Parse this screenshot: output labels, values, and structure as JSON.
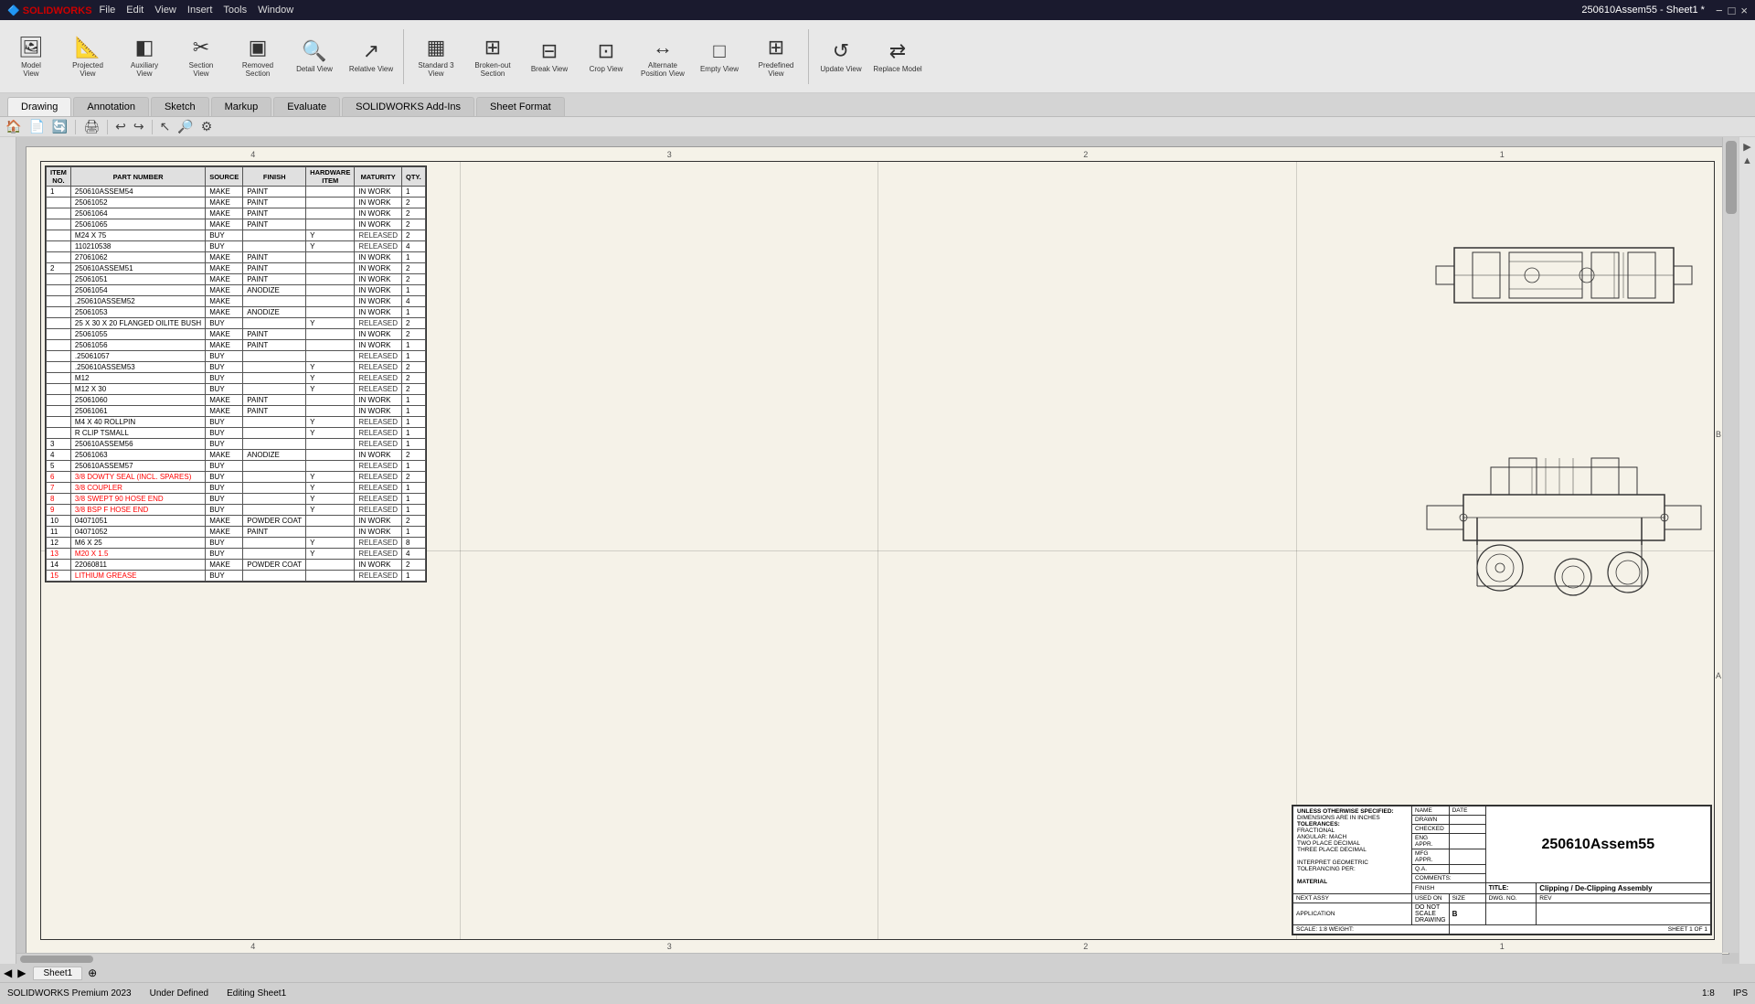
{
  "app": {
    "name": "SOLIDWORKS",
    "title": "250610Assem55 - Sheet1 *",
    "version": "SOLIDWORKS Premium 2023"
  },
  "menus": [
    "File",
    "Edit",
    "View",
    "Insert",
    "Tools",
    "Window"
  ],
  "toolbar": {
    "buttons": [
      {
        "id": "model-view",
        "label": "Model\nView",
        "icon": "🖼"
      },
      {
        "id": "projected-view",
        "label": "Projected\nView",
        "icon": "📐"
      },
      {
        "id": "auxiliary-view",
        "label": "Auxiliary\nView",
        "icon": "◧"
      },
      {
        "id": "section-view",
        "label": "Section\nView",
        "icon": "✂"
      },
      {
        "id": "removed-section",
        "label": "Removed\nSection",
        "icon": "▣"
      },
      {
        "id": "detail-view",
        "label": "Detail\nView",
        "icon": "🔍"
      },
      {
        "id": "relative-view",
        "label": "Relative\nView",
        "icon": "↗"
      },
      {
        "id": "standard-3-view",
        "label": "Standard\n3 View",
        "icon": "▦"
      },
      {
        "id": "broken-out-section",
        "label": "Broken-out\nSection",
        "icon": "⊞"
      },
      {
        "id": "break-view",
        "label": "Break\nView",
        "icon": "⊟"
      },
      {
        "id": "crop-view",
        "label": "Crop\nView",
        "icon": "⊡"
      },
      {
        "id": "alternate-position-view",
        "label": "Alternate\nPosition\nView",
        "icon": "↔"
      },
      {
        "id": "empty-view",
        "label": "Empty\nView",
        "icon": "□"
      },
      {
        "id": "predefined-view",
        "label": "Predefined\nView",
        "icon": "⊞"
      },
      {
        "id": "update-view",
        "label": "Update\nView",
        "icon": "↺"
      },
      {
        "id": "replace-model",
        "label": "Replace\nModel",
        "icon": "⇄"
      }
    ]
  },
  "tabs": [
    {
      "id": "drawing",
      "label": "Drawing"
    },
    {
      "id": "annotation",
      "label": "Annotation"
    },
    {
      "id": "sketch",
      "label": "Sketch"
    },
    {
      "id": "markup",
      "label": "Markup"
    },
    {
      "id": "evaluate",
      "label": "Evaluate"
    },
    {
      "id": "solidworks-addins",
      "label": "SOLIDWORKS Add-Ins"
    },
    {
      "id": "sheet-format",
      "label": "Sheet Format"
    }
  ],
  "active_tab": "Drawing",
  "bom": {
    "columns": [
      "ITEM NO.",
      "PART NUMBER",
      "SOURCE",
      "FINISH",
      "HARDWARE ITEM",
      "MATURITY",
      "QTY."
    ],
    "rows": [
      {
        "item": "1",
        "part": "250610ASSEM54",
        "source": "MAKE",
        "finish": "PAINT",
        "hw": "",
        "maturity": "IN WORK",
        "qty": "1",
        "red": false
      },
      {
        "item": "",
        "part": "25061052",
        "source": "MAKE",
        "finish": "PAINT",
        "hw": "",
        "maturity": "IN WORK",
        "qty": "2",
        "red": false
      },
      {
        "item": "",
        "part": "25061064",
        "source": "MAKE",
        "finish": "PAINT",
        "hw": "",
        "maturity": "IN WORK",
        "qty": "2",
        "red": false
      },
      {
        "item": "",
        "part": "25061065",
        "source": "MAKE",
        "finish": "PAINT",
        "hw": "",
        "maturity": "IN WORK",
        "qty": "2",
        "red": false
      },
      {
        "item": "",
        "part": "M24 X 75",
        "source": "BUY",
        "finish": "",
        "hw": "Y",
        "maturity": "RELEASED",
        "qty": "2",
        "red": false
      },
      {
        "item": "",
        "part": "110210538",
        "source": "BUY",
        "finish": "",
        "hw": "Y",
        "maturity": "RELEASED",
        "qty": "4",
        "red": false
      },
      {
        "item": "",
        "part": "27061062",
        "source": "MAKE",
        "finish": "PAINT",
        "hw": "",
        "maturity": "IN WORK",
        "qty": "1",
        "red": false
      },
      {
        "item": "2",
        "part": "250610ASSEM51",
        "source": "MAKE",
        "finish": "PAINT",
        "hw": "",
        "maturity": "IN WORK",
        "qty": "2",
        "red": false
      },
      {
        "item": "",
        "part": "25061051",
        "source": "MAKE",
        "finish": "PAINT",
        "hw": "",
        "maturity": "IN WORK",
        "qty": "2",
        "red": false
      },
      {
        "item": "",
        "part": "25061054",
        "source": "MAKE",
        "finish": "ANODIZE",
        "hw": "",
        "maturity": "IN WORK",
        "qty": "1",
        "red": false
      },
      {
        "item": "",
        "part": ".250610ASSEM52",
        "source": "MAKE",
        "finish": "",
        "hw": "",
        "maturity": "IN WORK",
        "qty": "4",
        "red": false
      },
      {
        "item": "",
        "part": "25061053",
        "source": "MAKE",
        "finish": "ANODIZE",
        "hw": "",
        "maturity": "IN WORK",
        "qty": "1",
        "red": false
      },
      {
        "item": "",
        "part": "25 X 30 X 20 FLANGED OILITE BUSH",
        "source": "BUY",
        "finish": "",
        "hw": "Y",
        "maturity": "RELEASED",
        "qty": "2",
        "red": false
      },
      {
        "item": "",
        "part": "25061055",
        "source": "MAKE",
        "finish": "PAINT",
        "hw": "",
        "maturity": "IN WORK",
        "qty": "2",
        "red": false
      },
      {
        "item": "",
        "part": "25061056",
        "source": "MAKE",
        "finish": "PAINT",
        "hw": "",
        "maturity": "IN WORK",
        "qty": "1",
        "red": false
      },
      {
        "item": "",
        "part": ".25061057",
        "source": "BUY",
        "finish": "",
        "hw": "",
        "maturity": "RELEASED",
        "qty": "1",
        "red": false
      },
      {
        "item": "",
        "part": ".250610ASSEM53",
        "source": "BUY",
        "finish": "",
        "hw": "Y",
        "maturity": "RELEASED",
        "qty": "2",
        "red": false
      },
      {
        "item": "",
        "part": "M12",
        "source": "BUY",
        "finish": "",
        "hw": "Y",
        "maturity": "RELEASED",
        "qty": "2",
        "red": false
      },
      {
        "item": "",
        "part": "M12 X 30",
        "source": "BUY",
        "finish": "",
        "hw": "Y",
        "maturity": "RELEASED",
        "qty": "2",
        "red": false
      },
      {
        "item": "",
        "part": "25061060",
        "source": "MAKE",
        "finish": "PAINT",
        "hw": "",
        "maturity": "IN WORK",
        "qty": "1",
        "red": false
      },
      {
        "item": "",
        "part": "25061061",
        "source": "MAKE",
        "finish": "PAINT",
        "hw": "",
        "maturity": "IN WORK",
        "qty": "1",
        "red": false
      },
      {
        "item": "",
        "part": "M4 X 40 ROLLPIN",
        "source": "BUY",
        "finish": "",
        "hw": "Y",
        "maturity": "RELEASED",
        "qty": "1",
        "red": false
      },
      {
        "item": "",
        "part": "R CLIP TSMALL",
        "source": "BUY",
        "finish": "",
        "hw": "Y",
        "maturity": "RELEASED",
        "qty": "1",
        "red": false
      },
      {
        "item": "3",
        "part": "250610ASSEM56",
        "source": "BUY",
        "finish": "",
        "hw": "",
        "maturity": "RELEASED",
        "qty": "1",
        "red": false
      },
      {
        "item": "4",
        "part": "25061063",
        "source": "MAKE",
        "finish": "ANODIZE",
        "hw": "",
        "maturity": "IN WORK",
        "qty": "2",
        "red": false
      },
      {
        "item": "5",
        "part": "250610ASSEM57",
        "source": "BUY",
        "finish": "",
        "hw": "",
        "maturity": "RELEASED",
        "qty": "1",
        "red": false
      },
      {
        "item": "6",
        "part": "3/8 DOWTY SEAL (INCL. SPARES)",
        "source": "BUY",
        "finish": "",
        "hw": "Y",
        "maturity": "RELEASED",
        "qty": "2",
        "red": true
      },
      {
        "item": "7",
        "part": "3/8 COUPLER",
        "source": "BUY",
        "finish": "",
        "hw": "Y",
        "maturity": "RELEASED",
        "qty": "1",
        "red": true
      },
      {
        "item": "8",
        "part": "3/8 SWEPT 90 HOSE END",
        "source": "BUY",
        "finish": "",
        "hw": "Y",
        "maturity": "RELEASED",
        "qty": "1",
        "red": true
      },
      {
        "item": "9",
        "part": "3/8 BSP F HOSE END",
        "source": "BUY",
        "finish": "",
        "hw": "Y",
        "maturity": "RELEASED",
        "qty": "1",
        "red": true
      },
      {
        "item": "10",
        "part": "04071051",
        "source": "MAKE",
        "finish": "POWDER COAT",
        "hw": "",
        "maturity": "IN WORK",
        "qty": "2",
        "red": false
      },
      {
        "item": "11",
        "part": "04071052",
        "source": "MAKE",
        "finish": "PAINT",
        "hw": "",
        "maturity": "IN WORK",
        "qty": "1",
        "red": false
      },
      {
        "item": "12",
        "part": "M6 X 25",
        "source": "BUY",
        "finish": "",
        "hw": "Y",
        "maturity": "RELEASED",
        "qty": "8",
        "red": false
      },
      {
        "item": "13",
        "part": "M20 X 1.5",
        "source": "BUY",
        "finish": "",
        "hw": "Y",
        "maturity": "RELEASED",
        "qty": "4",
        "red": true
      },
      {
        "item": "14",
        "part": "22060811",
        "source": "MAKE",
        "finish": "POWDER COAT",
        "hw": "",
        "maturity": "IN WORK",
        "qty": "2",
        "red": false
      },
      {
        "item": "15",
        "part": "LITHIUM GREASE",
        "source": "BUY",
        "finish": "",
        "hw": "",
        "maturity": "RELEASED",
        "qty": "1",
        "red": true
      }
    ]
  },
  "title_block": {
    "drawing_number": "250610Assem55",
    "title": "Clipping / De-Clipping Assembly",
    "size": "B",
    "dwg_no": "",
    "rev": "",
    "scale": "1:8",
    "weight": "",
    "sheet": "SHEET 1 OF 1",
    "unless_specified": "UNLESS OTHERWISE SPECIFIED:",
    "dimensions": "DIMENSIONS ARE IN INCHES",
    "tolerances": "TOLERANCES:",
    "fractional": "FRACTIONAL",
    "angular": "ANGULAR: MACH",
    "two_place": "TWO PLACE DECIMAL",
    "three_place": "THREE PLACE DECIMAL",
    "interpret": "INTERPRET GEOMETRIC",
    "tolerancing_per": "TOLERANCING PER:",
    "material": "MATERIAL",
    "finish_label": "FINISH",
    "do_not_scale": "DO NOT SCALE DRAWING",
    "name_label": "NAME",
    "date_label": "DATE",
    "drawn": "DRAWN",
    "checked": "CHECKED",
    "eng_appr": "ENG APPR.",
    "mfg_appr": "MFG APPR.",
    "qa": "Q.A.",
    "comments": "COMMENTS:",
    "next_assy": "NEXT ASSY",
    "used_on": "USED ON",
    "application": "APPLICATION"
  },
  "column_markers": [
    "4",
    "3",
    "2",
    "1"
  ],
  "row_markers": [
    "B",
    "A"
  ],
  "sheet_tabs": [
    {
      "label": "Sheet1",
      "active": true
    }
  ],
  "status": {
    "status1": "Under Defined",
    "status2": "Editing Sheet1",
    "scale": "1:8",
    "units": "IPS"
  }
}
